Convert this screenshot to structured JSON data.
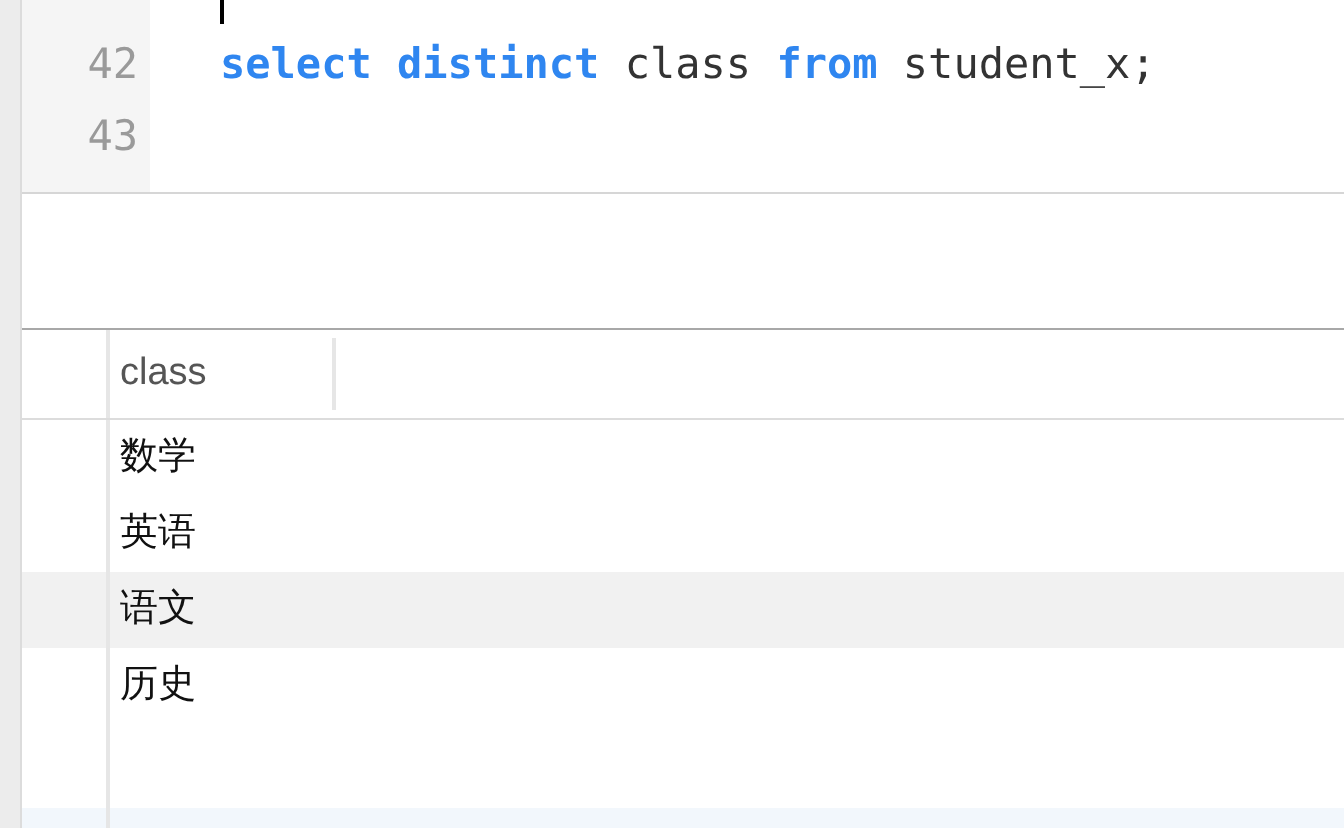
{
  "editor": {
    "lines": [
      {
        "number": "42",
        "tokens": [
          {
            "text": "select ",
            "kind": "keyword"
          },
          {
            "text": "distinct",
            "kind": "keyword"
          },
          {
            "text": " class ",
            "kind": "plain"
          },
          {
            "text": "from",
            "kind": "keyword"
          },
          {
            "text": " student_x;",
            "kind": "plain"
          }
        ]
      },
      {
        "number": "43"
      }
    ]
  },
  "results": {
    "columns": [
      "class"
    ],
    "rows": [
      {
        "cells": [
          "数学"
        ],
        "shaded": false
      },
      {
        "cells": [
          "英语"
        ],
        "shaded": false
      },
      {
        "cells": [
          "语文"
        ],
        "shaded": true
      },
      {
        "cells": [
          "历史"
        ],
        "shaded": false
      }
    ]
  }
}
